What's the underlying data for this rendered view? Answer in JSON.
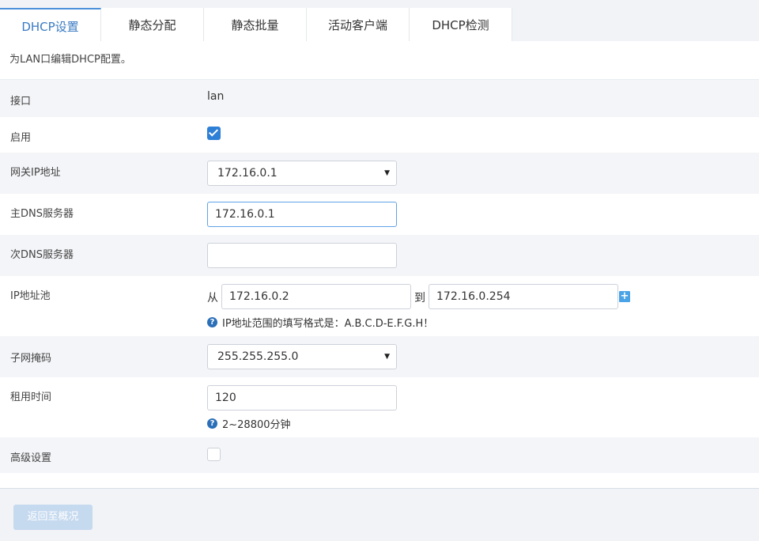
{
  "tabs": [
    {
      "label": "DHCP设置",
      "active": true
    },
    {
      "label": "静态分配",
      "active": false
    },
    {
      "label": "静态批量",
      "active": false
    },
    {
      "label": "活动客户端",
      "active": false
    },
    {
      "label": "DHCP检测",
      "active": false
    }
  ],
  "description": "为LAN口编辑DHCP配置。",
  "form": {
    "interface": {
      "label": "接口",
      "value": "lan"
    },
    "enable": {
      "label": "启用",
      "checked": true
    },
    "gateway": {
      "label": "网关IP地址",
      "value": "172.16.0.1"
    },
    "primary_dns": {
      "label": "主DNS服务器",
      "value": "172.16.0.1"
    },
    "secondary_dns": {
      "label": "次DNS服务器",
      "value": ""
    },
    "ip_pool": {
      "label": "IP地址池",
      "from_label": "从",
      "from_value": "172.16.0.2",
      "to_label": "到",
      "to_value": "172.16.0.254",
      "add_icon": "plus-icon",
      "hint": "IP地址范围的填写格式是：A.B.C.D-E.F.G.H！"
    },
    "subnet_mask": {
      "label": "子网掩码",
      "value": "255.255.255.0"
    },
    "lease_time": {
      "label": "租用时间",
      "value": "120",
      "hint": "2~28800分钟"
    },
    "advanced": {
      "label": "高级设置",
      "checked": false
    }
  },
  "help_icon_glyph": "?",
  "back_button": "返回至概况",
  "colors": {
    "accent": "#3a7bc2",
    "checkbox_on": "#2e7fd6",
    "help_icon": "#2b6fb8",
    "back_button_bg": "#c5d9ef",
    "focused_border": "#5fa3e6"
  }
}
